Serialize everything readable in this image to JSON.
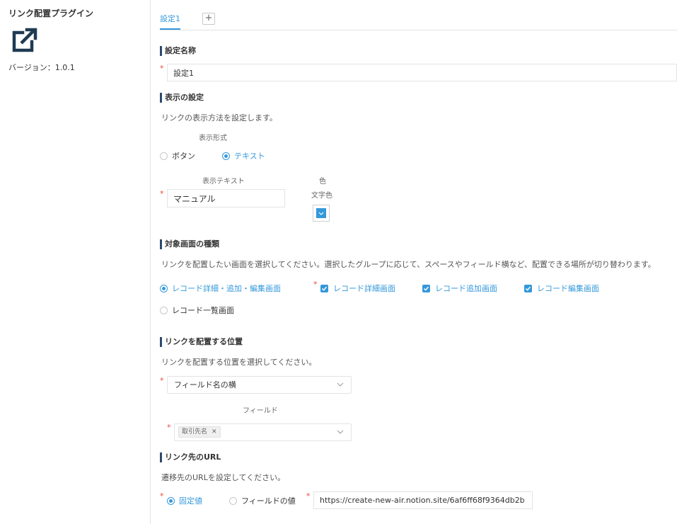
{
  "plugin": {
    "title": "リンク配置プラグイン",
    "version": "バージョン：1.0.1",
    "icon": "external-link-icon"
  },
  "tabs": {
    "items": [
      {
        "label": "設定1"
      }
    ],
    "add_label": "+"
  },
  "sections": {
    "name": {
      "title": "設定名称",
      "value": "設定1"
    },
    "display": {
      "title": "表示の設定",
      "description": "リンクの表示方法を設定します。",
      "format_label": "表示形式",
      "options": [
        "ボタン",
        "テキスト"
      ],
      "selected": "テキスト",
      "text_label": "表示テキスト",
      "text_value": "マニュアル",
      "color_group_label": "色",
      "color_label": "文字色",
      "color_value": "#3498db"
    },
    "target": {
      "title": "対象画面の種類",
      "description": "リンクを配置したい画面を選択してください。選択したグループに応じて、スペースやフィールド横など、配置できる場所が切り替わります。",
      "groups": [
        "レコード詳細・追加・編集画面",
        "レコード一覧画面"
      ],
      "selected_group": "レコード詳細・追加・編集画面",
      "checks": [
        "レコード詳細画面",
        "レコード追加画面",
        "レコード編集画面"
      ]
    },
    "position": {
      "title": "リンクを配置する位置",
      "description": "リンクを配置する位置を選択してください。",
      "selected": "フィールド名の横",
      "field_label": "フィールド",
      "field_tag": "取引先名"
    },
    "url": {
      "title": "リンク先のURL",
      "description": "遷移先のURLを設定してください。",
      "options": [
        "固定値",
        "フィールドの値"
      ],
      "selected": "固定値",
      "value": "https://create-new-air.notion.site/6af6ff68f9364db2b"
    }
  },
  "colors": {
    "accent": "#3498db",
    "section_bar": "#2c4a6e",
    "required": "#e74c3c"
  }
}
